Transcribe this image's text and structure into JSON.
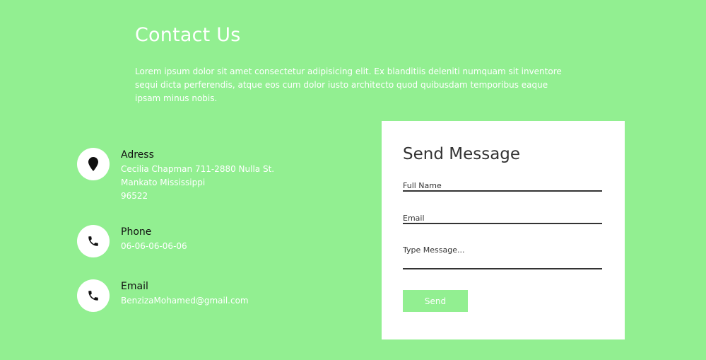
{
  "header": {
    "title": "Contact Us",
    "description": "Lorem ipsum dolor sit amet consectetur adipisicing elit. Ex blanditiis deleniti numquam sit inventore sequi dicta perferendis, atque eos cum dolor iusto architecto quod quibusdam temporibus eaque ipsam minus nobis."
  },
  "contact": {
    "address": {
      "label": "Adress",
      "line1": "Cecilia Chapman 711-2880 Nulla St.",
      "line2": "Mankato Mississippi",
      "line3": "96522",
      "icon": "map-pin-icon"
    },
    "phone": {
      "label": "Phone",
      "value": "06-06-06-06-06",
      "icon": "phone-icon"
    },
    "email": {
      "label": "Email",
      "value": "BenzizaMohamed@gmail.com",
      "icon": "phone-icon"
    }
  },
  "form": {
    "title": "Send Message",
    "name_placeholder": "Full Name",
    "email_placeholder": "Email",
    "message_placeholder": "Type Message...",
    "send_label": "Send"
  },
  "colors": {
    "background": "#92ef91",
    "card": "#ffffff",
    "button": "#92ef91"
  }
}
